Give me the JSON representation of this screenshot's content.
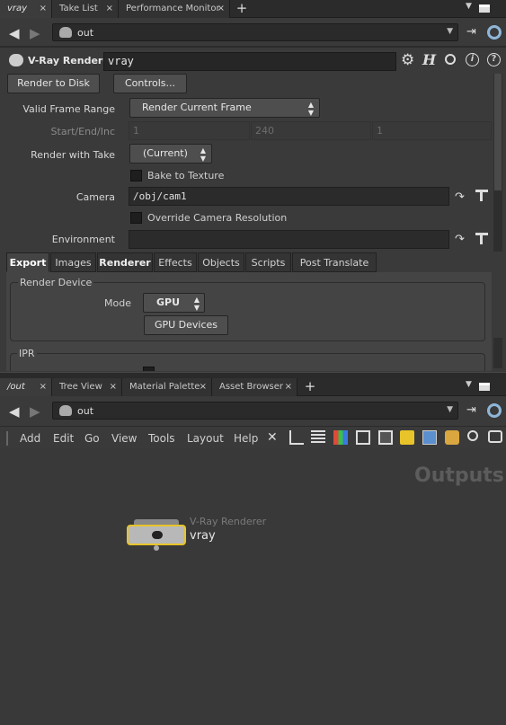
{
  "top_tabs": [
    {
      "label": "vray"
    },
    {
      "label": "Take List"
    },
    {
      "label": "Performance Monitor"
    }
  ],
  "top_path": {
    "value": "out"
  },
  "node_header": {
    "type": "V-Ray Renderer",
    "name": "vray"
  },
  "buttons": {
    "render_to_disk": "Render to Disk",
    "controls": "Controls..."
  },
  "params": {
    "valid_frame_range": {
      "label": "Valid Frame Range",
      "value": "Render Current Frame"
    },
    "start_end_inc": {
      "label": "Start/End/Inc",
      "values": [
        "1",
        "240",
        "1"
      ]
    },
    "render_with_take": {
      "label": "Render with Take",
      "value": "(Current)"
    },
    "bake_to_texture": {
      "label": "Bake to Texture"
    },
    "camera": {
      "label": "Camera",
      "value": "/obj/cam1"
    },
    "override_cam_res": {
      "label": "Override Camera Resolution"
    },
    "environment": {
      "label": "Environment",
      "value": ""
    }
  },
  "param_tabs": [
    "Export",
    "Images",
    "Renderer",
    "Effects",
    "Objects",
    "Scripts",
    "Post Translate"
  ],
  "render_device": {
    "title": "Render Device",
    "mode_label": "Mode",
    "mode_value": "GPU",
    "gpu_devices": "GPU Devices"
  },
  "ipr": {
    "title": "IPR"
  },
  "bottom_tabs": [
    {
      "label": "/out"
    },
    {
      "label": "Tree View"
    },
    {
      "label": "Material Palette"
    },
    {
      "label": "Asset Browser"
    }
  ],
  "bottom_path": {
    "value": "out"
  },
  "menu": [
    "Add",
    "Edit",
    "Go",
    "View",
    "Tools",
    "Layout",
    "Help"
  ],
  "network": {
    "context_label": "Outputs",
    "node_type": "V-Ray Renderer",
    "node_name": "vray"
  },
  "colors": {
    "accent_yellow": "#e8c42a",
    "bg_panel": "#3a3a3a",
    "bg_network": "#393939"
  }
}
